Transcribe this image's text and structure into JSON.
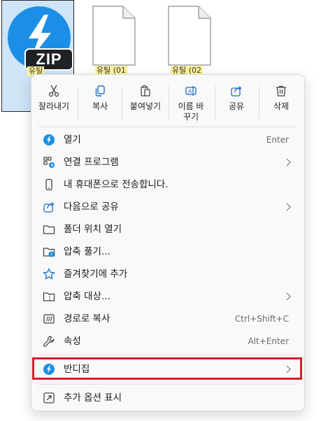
{
  "files": [
    {
      "name": "유틸",
      "type": "zip",
      "selected": true
    },
    {
      "name": "유틸 (01",
      "type": "document",
      "selected": false
    },
    {
      "name": "유틸 (02",
      "type": "document",
      "selected": false
    }
  ],
  "zip_badge_text": "ZIP",
  "toolbar": [
    {
      "label": "잘라내기",
      "icon": "scissors-icon"
    },
    {
      "label": "복사",
      "icon": "copy-icon"
    },
    {
      "label": "붙여넣기",
      "icon": "paste-icon"
    },
    {
      "label": "이름 바꾸기",
      "icon": "rename-icon"
    },
    {
      "label": "공유",
      "icon": "share-icon"
    },
    {
      "label": "삭제",
      "icon": "trash-icon"
    }
  ],
  "menu": {
    "open": {
      "label": "열기",
      "shortcut": "Enter",
      "icon": "bandizip-icon"
    },
    "open_with": {
      "label": "연결 프로그램",
      "icon": "open-with-icon",
      "submenu": true
    },
    "send_phone": {
      "label": "내 휴대폰으로 전송합니다.",
      "icon": "phone-icon"
    },
    "share_with": {
      "label": "다음으로 공유",
      "icon": "share-icon",
      "submenu": true
    },
    "open_folder": {
      "label": "폴더 위치 열기",
      "icon": "folder-icon"
    },
    "extract": {
      "label": "압축 풀기...",
      "icon": "extract-folder-icon"
    },
    "favorite": {
      "label": "즐겨찾기에 추가",
      "icon": "star-icon"
    },
    "compress": {
      "label": "압축 대상...",
      "icon": "compress-icon",
      "submenu": true
    },
    "copy_path": {
      "label": "경로로 복사",
      "shortcut": "Ctrl+Shift+C",
      "icon": "copy-path-icon"
    },
    "properties": {
      "label": "속성",
      "shortcut": "Alt+Enter",
      "icon": "wrench-icon"
    },
    "bandizip": {
      "label": "반디집",
      "icon": "bandizip-icon",
      "submenu": true,
      "highlighted": true
    },
    "more_options": {
      "label": "추가 옵션 표시",
      "icon": "more-options-icon"
    }
  },
  "colors": {
    "accent": "#1b8fe6",
    "highlight_border": "#d4202a",
    "selection_bg": "#cfe4f7",
    "label_highlight": "#fff59a"
  }
}
